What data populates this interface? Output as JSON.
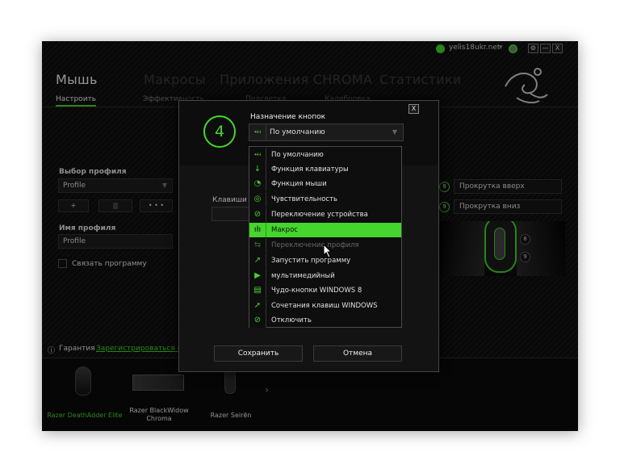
{
  "titlebar": {
    "username": "yelis18ukr.net",
    "dropdown_icon": "▾",
    "settings_icon": "⚙",
    "minimize": "—",
    "close": "X"
  },
  "nav": {
    "items": [
      "Мышь",
      "Макросы",
      "Приложения CHROMA",
      "Статистики"
    ]
  },
  "subnav": {
    "items": [
      "Настроить",
      "Эффективность",
      "Подсветка",
      "Калибровка"
    ]
  },
  "left": {
    "profile_label": "Выбор профиля",
    "profile_value": "Profile",
    "add_btn": "+",
    "more_btn": "• • •",
    "profile_name_label": "Имя профиля",
    "profile_name_value": "Profile",
    "link_program": "Связать программу"
  },
  "right": {
    "scroll_up_num": "8",
    "scroll_up": "Прокрутка вверх",
    "scroll_down_num": "9",
    "scroll_down": "Прокрутка вниз",
    "mouse_btn_8": "8",
    "mouse_btn_9": "9"
  },
  "bottom": {
    "warranty_icon": "ⓘ",
    "warranty": "Гарантия",
    "register": "Зарегистрироваться сейчас"
  },
  "devices": [
    {
      "name": "Razer DeathAdder Elite",
      "active": true
    },
    {
      "name": "Razer BlackWidow Chroma"
    },
    {
      "name": "Razer Seirēn"
    }
  ],
  "devices_next": "›",
  "dialog": {
    "close": "X",
    "button_number": "4",
    "label": "Назначение кнопок",
    "selected": "По умолчанию",
    "arrow": "▼",
    "keys_label": "Клавиши п",
    "options": [
      {
        "label": "По умолчанию",
        "icon": "default-icon"
      },
      {
        "label": "Функция клавиатуры",
        "icon": "keyboard-function-icon"
      },
      {
        "label": "Функция мыши",
        "icon": "mouse-function-icon"
      },
      {
        "label": "Чувствительность",
        "icon": "sensitivity-icon"
      },
      {
        "label": "Переключение устройства",
        "icon": "device-switch-icon"
      },
      {
        "label": "Макрос",
        "icon": "macro-icon",
        "selected": true
      },
      {
        "label": "Переключение профиля",
        "icon": "profile-switch-icon",
        "disabled": true
      },
      {
        "label": "Запустить программу",
        "icon": "launch-program-icon"
      },
      {
        "label": "мультимедийный",
        "icon": "multimedia-icon"
      },
      {
        "label": "Чудо-кнопки WINDOWS 8",
        "icon": "windows8-charms-icon"
      },
      {
        "label": "Сочетания клавиш WINDOWS",
        "icon": "windows-shortcuts-icon"
      },
      {
        "label": "Отключить",
        "icon": "disable-icon"
      }
    ],
    "save": "Сохранить",
    "cancel": "Отмена"
  },
  "colors": {
    "accent": "#44d62c",
    "background": "#101010"
  }
}
